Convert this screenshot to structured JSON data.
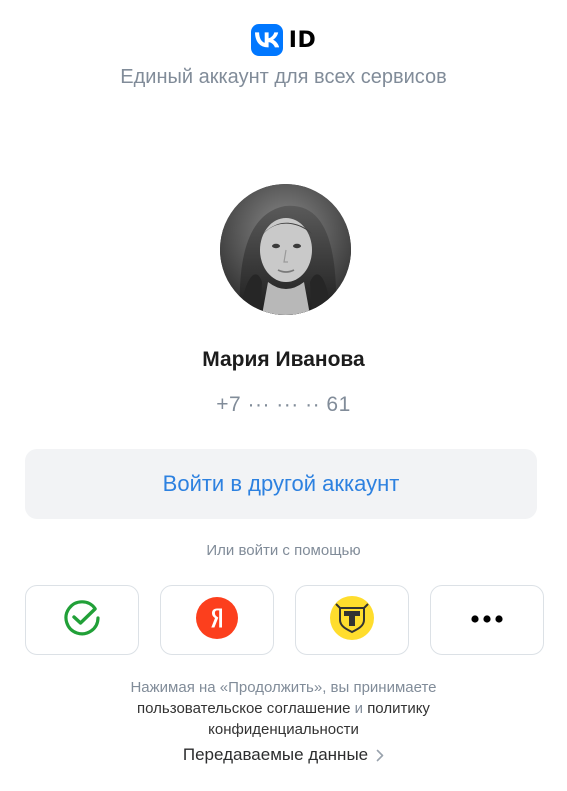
{
  "header": {
    "brand_suffix": "ID",
    "subtitle": "Единый аккаунт для всех сервисов"
  },
  "account": {
    "name": "Мария Иванова",
    "phone": "+7 ··· ··· ·· 61"
  },
  "actions": {
    "switch_account_label": "Войти в другой аккаунт",
    "alt_login_label": "Или войти с помощью"
  },
  "providers": [
    {
      "name": "sber-icon",
      "color": "#21a038"
    },
    {
      "name": "yandex-icon",
      "color": "#fc3f1d"
    },
    {
      "name": "tinkoff-icon",
      "color": "#ffdd2d"
    },
    {
      "name": "more-icon",
      "color": "#000000"
    }
  ],
  "legal": {
    "line1": "Нажимая на «Продолжить», вы принимаете",
    "user_agreement": "пользовательское соглашение",
    "conjunction": "и",
    "policy": "политику",
    "policy_cont": "конфиденциальности"
  },
  "footer": {
    "transferred_data_label": "Передаваемые данные"
  },
  "colors": {
    "accent": "#2d81e0",
    "vk_blue": "#0077ff",
    "secondary_text": "#818c99",
    "button_bg": "#f2f3f5"
  }
}
